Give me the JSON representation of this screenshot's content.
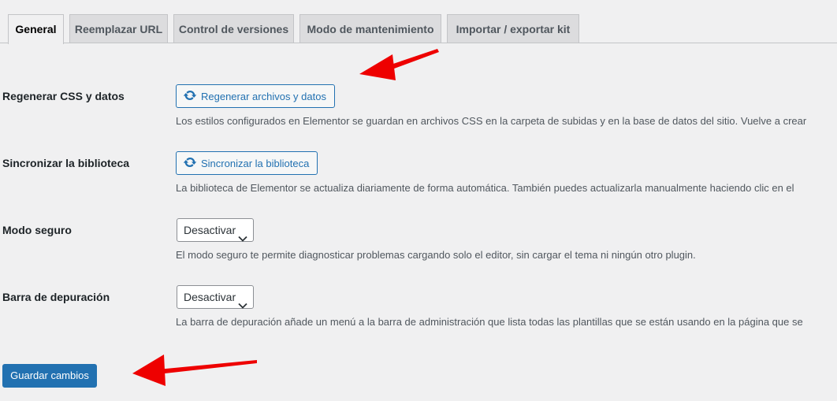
{
  "tabs": [
    {
      "label": "General",
      "active": true
    },
    {
      "label": "Reemplazar URL",
      "active": false
    },
    {
      "label": "Control de versiones",
      "active": false
    },
    {
      "label": "Modo de mantenimiento",
      "active": false
    },
    {
      "label": "Importar / exportar kit",
      "active": false
    }
  ],
  "rows": {
    "regenerate": {
      "label": "Regenerar CSS y datos",
      "button": "Regenerar archivos y datos",
      "icon": "sync-icon",
      "description": "Los estilos configurados en Elementor se guardan en archivos CSS en la carpeta de subidas y en la base de datos del sitio. Vuelve a crear"
    },
    "sync": {
      "label": "Sincronizar la biblioteca",
      "button": "Sincronizar la biblioteca",
      "icon": "sync-icon",
      "description": "La biblioteca de Elementor se actualiza diariamente de forma automática. También puedes actualizarla manualmente haciendo clic en el"
    },
    "safe_mode": {
      "label": "Modo seguro",
      "select_value": "Desactivar",
      "description": "El modo seguro te permite diagnosticar problemas cargando solo el editor, sin cargar el tema ni ningún otro plugin."
    },
    "debug_bar": {
      "label": "Barra de depuración",
      "select_value": "Desactivar",
      "description": "La barra de depuración añade un menú a la barra de administración que lista todas las plantillas que se están usando en la página que se"
    }
  },
  "save_button": "Guardar cambios",
  "colors": {
    "accent": "#2271b1",
    "annotation_arrow": "#ee0000",
    "background": "#f0f0f1"
  }
}
